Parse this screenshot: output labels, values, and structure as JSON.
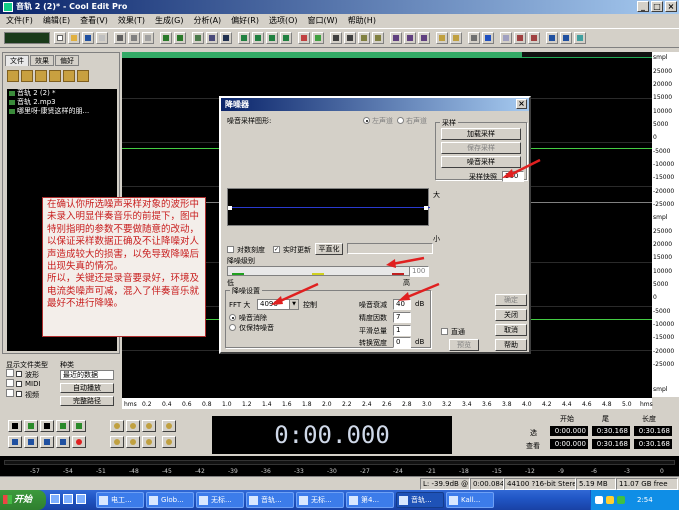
{
  "window": {
    "title": "音轨  2 (2)* - Cool Edit Pro",
    "buttons": {
      "minimize": "_",
      "maximize": "□",
      "close": "×"
    }
  },
  "menubar": [
    "文件(F)",
    "编辑(E)",
    "查看(V)",
    "效果(T)",
    "生成(G)",
    "分析(A)",
    "偏好(R)",
    "选项(O)",
    "窗口(W)",
    "帮助(H)"
  ],
  "left_panel": {
    "tabs": [
      "文件",
      "效果",
      "偏好"
    ],
    "files": [
      "音轨 2 (2) *",
      "音轨 2.mp3",
      "哪里呀-康贤这样的朋..."
    ],
    "show_type_label": "显示文件类型",
    "sort_label": "种类",
    "types": [
      "波形",
      "MIDI",
      "视频"
    ],
    "sort_value": "最近的数据",
    "buttons": [
      "自动播放",
      "完整路径"
    ]
  },
  "wave": {
    "scale_labels": [
      "smpl",
      "25000",
      "20000",
      "15000",
      "10000",
      "5000",
      "0",
      "-5000",
      "-10000",
      "-15000",
      "-20000",
      "-25000",
      "smpl",
      "25000",
      "20000",
      "15000",
      "10000",
      "5000",
      "0",
      "-5000",
      "-10000",
      "-15000",
      "-20000",
      "-25000",
      "smpl"
    ],
    "ruler_unit": "hms",
    "ruler_labels": [
      "0.2",
      "0.4",
      "0.6",
      "0.8",
      "1.0",
      "1.2",
      "1.4",
      "1.6",
      "1.8",
      "2.0",
      "2.2",
      "2.4",
      "2.6",
      "2.8",
      "3.0",
      "3.2",
      "3.4",
      "3.6",
      "3.8",
      "4.0",
      "4.2",
      "4.4",
      "4.6",
      "4.8",
      "5.0"
    ]
  },
  "transport": {
    "time": "0:00.000"
  },
  "selection_info": {
    "headers": [
      "开始",
      "尾",
      "长度"
    ],
    "rows": [
      {
        "label": "选",
        "start": "0:00.000",
        "end": "0:30.168",
        "length": "0:30.168"
      },
      {
        "label": "查看",
        "start": "0:00.000",
        "end": "0:30.168",
        "length": "0:30.168"
      }
    ]
  },
  "level_meter": {
    "labels": [
      "-57",
      "-54",
      "-51",
      "-48",
      "-45",
      "-42",
      "-39",
      "-36",
      "-33",
      "-30",
      "-27",
      "-24",
      "-21",
      "-18",
      "-15",
      "-12",
      "-9",
      "-6",
      "-3",
      "0"
    ]
  },
  "statusbar": {
    "level": "L: -39.9dB @",
    "position": "0:00.084",
    "format": "44100 ?16-bit Stereo",
    "size": "5.19 MB",
    "free": "11.07 GB free"
  },
  "taskbar": {
    "start": "开始",
    "tasks": [
      "电工...",
      "Glob...",
      "无标...",
      "音轨...",
      "无标...",
      "第4...",
      "音轨...",
      "Kall..."
    ],
    "tray_time": "2:54"
  },
  "dialog": {
    "title": "降噪器",
    "profile_group": "噪音采样图形:",
    "channel_left": "左声道",
    "channel_right": "右声道",
    "sample_group": "采样",
    "load_btn": "加载采样",
    "save_btn": "保存采样",
    "get_btn": "噪音采样",
    "snapshot_label": "采样快照",
    "snapshot_value": "300",
    "axis_high": "大",
    "axis_low": "小",
    "log_scale": "对数刻度",
    "realtime": "实时更新",
    "flatten_btn": "平直化",
    "level_label": "降噪级别",
    "slider_value": "100",
    "slider_low": "低",
    "slider_high": "高",
    "settings_group": "降噪设置",
    "fft_label": "FFT 大",
    "fft_value": "4096",
    "control_label": "控制",
    "radio1": "噪音消除",
    "radio2": "仅保持噪音",
    "level_db_label": "噪音衰减",
    "level_db_value": "40",
    "level_db_unit": "dB",
    "precision_label": "精度因数",
    "precision_value": "7",
    "smooth_label": "平滑总量",
    "smooth_value": "1",
    "trans_label": "转换宽度",
    "trans_value": "0",
    "trans_unit": "dB",
    "ok_btn": "确定",
    "close_btn": "关闭",
    "cancel_btn": "取消",
    "help_btn": "帮助",
    "bypass": "直通",
    "preview_btn": "预览"
  },
  "annotation": {
    "text": "在确认你所选噪声采样对象的波形中未录入明显伴奏音乐的前提下，图中特别指明的参数不要做随意的改动，以保证采样数据正确及不让降噪对人声造成较大的损害，以免导致降噪后出现失真的情况。\n所以，关键还是录音要录好，环境及电流类噪声可减，混入了伴奏音乐就最好不进行降噪。"
  },
  "colors": {
    "titlebar": "#0a246a",
    "waveform": "#44cc44",
    "annotation_text": "#c81e1e",
    "arrow": "#e02020"
  }
}
